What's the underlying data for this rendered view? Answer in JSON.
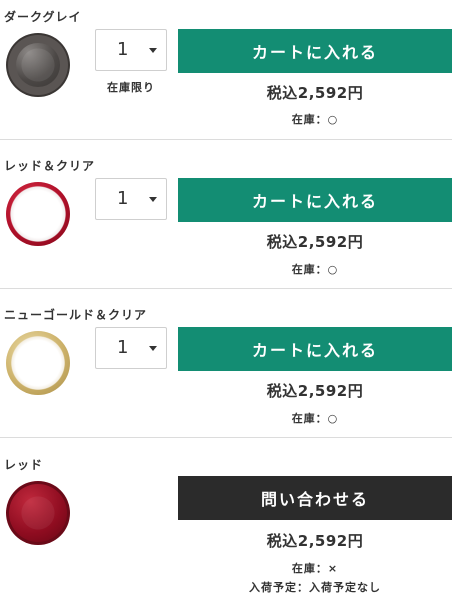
{
  "colors": {
    "cart_button": "#138d73",
    "inquiry_button": "#2b2b2b",
    "text": "#333333",
    "divider": "#dcdcdc"
  },
  "variants": [
    {
      "name": "ダークグレイ",
      "quantity": "1",
      "stock_limit": "在庫限り",
      "action_label": "カートに入れる",
      "price": "税込2,592円",
      "stock": "在庫：○"
    },
    {
      "name": "レッド＆クリア",
      "quantity": "1",
      "action_label": "カートに入れる",
      "price": "税込2,592円",
      "stock": "在庫：○"
    },
    {
      "name": "ニューゴールド＆クリア",
      "quantity": "1",
      "action_label": "カートに入れる",
      "price": "税込2,592円",
      "stock": "在庫：○"
    },
    {
      "name": "レッド",
      "action_label": "問い合わせる",
      "price": "税込2,592円",
      "stock": "在庫：×",
      "arrival": "入荷予定：入荷予定なし"
    }
  ]
}
